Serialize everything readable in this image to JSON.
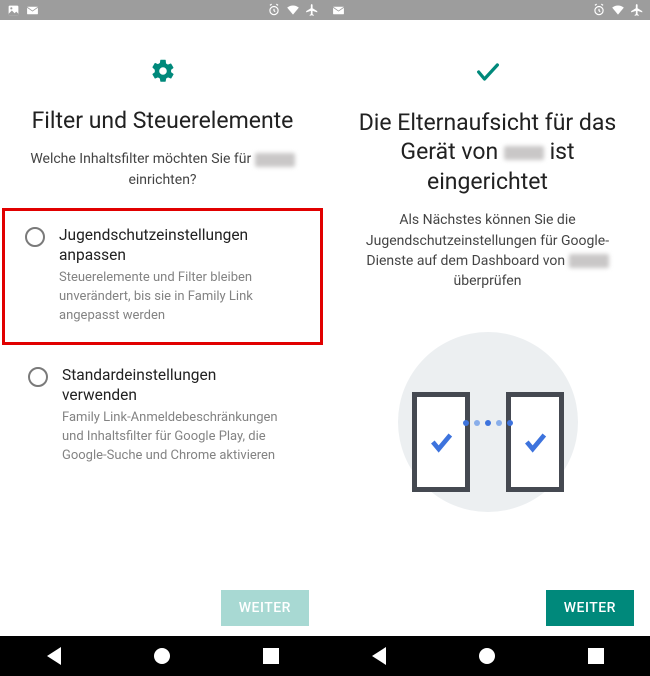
{
  "left": {
    "title": "Filter und Steuerelemente",
    "subtitle_pre": "Welche Inhaltsfilter möchten Sie für ",
    "subtitle_post": " einrichten?",
    "option1": {
      "title": "Jugendschutzeinstellungen anpassen",
      "desc": "Steuerelemente und Filter bleiben unverändert, bis sie in Family Link angepasst werden"
    },
    "option2": {
      "title": "Standardeinstellungen verwenden",
      "desc": "Family Link-Anmeldebeschränkungen und Inhaltsfilter für Google Play, die Google-Suche und Chrome aktivieren"
    },
    "button": "WEITER"
  },
  "right": {
    "title_pre": "Die Elternaufsicht für das Gerät von ",
    "title_post": " ist eingerichtet",
    "subtitle_pre": "Als Nächstes können Sie die Jugendschutzeinstellungen für Google-Dienste auf dem Dashboard von ",
    "subtitle_post": " überprüfen",
    "button": "WEITER"
  },
  "icons": {
    "gear": "gear-icon",
    "check": "check-icon",
    "image": "image-icon",
    "mail": "mail-icon",
    "alarm": "alarm-icon",
    "wifi": "wifi-icon",
    "airplane": "airplane-icon"
  }
}
